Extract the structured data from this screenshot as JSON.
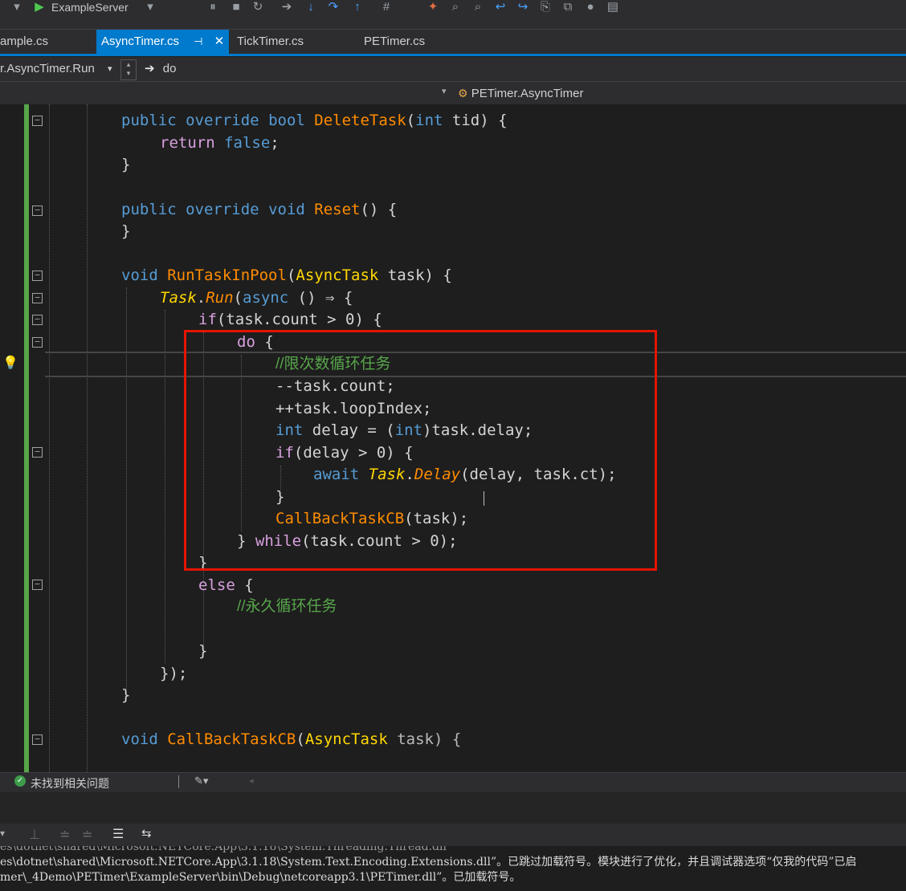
{
  "toolbar": {
    "run_target": "ExampleServer"
  },
  "tabs": [
    {
      "label": "ample.cs"
    },
    {
      "label": "AsyncTimer.cs"
    },
    {
      "label": "TickTimer.cs"
    },
    {
      "label": "PETimer.cs"
    }
  ],
  "nav": {
    "member_dropdown": "r.AsyncTimer.Run",
    "scope": "do",
    "class_dropdown": "PETimer.AsyncTimer"
  },
  "code": {
    "l1": {
      "a": "public",
      "b": "override",
      "c": "bool",
      "fn": "DeleteTask",
      "p1": "(",
      "t": "int",
      "rest": " tid) {"
    },
    "l2": {
      "kw": "return",
      "v": "false",
      "end": ";"
    },
    "l3": "}",
    "l4": {
      "a": "public",
      "b": "override",
      "c": "void",
      "fn": "Reset",
      "rest": "() {"
    },
    "l5": "}",
    "l6": {
      "a": "void",
      "fn": "RunTaskInPool",
      "p1": "(",
      "ty": "AsyncTask",
      "rest": " task) {"
    },
    "l7": {
      "ty": "Task",
      "dot": ".",
      "fn": "Run",
      "p": "(",
      "kw": "async",
      "rest": " () ⇒ {"
    },
    "l8": {
      "kw": "if",
      "rest": "(task.count > 0) {"
    },
    "l9": {
      "kw": "do",
      "rest": " {"
    },
    "l10": "//限次数循环任务",
    "l11": "--task.count;",
    "l12": "++task.loopIndex;",
    "l13": {
      "kw": "int",
      "a": " delay = (",
      "kw2": "int",
      "rest": ")task.delay;"
    },
    "l14": {
      "kw": "if",
      "rest": "(delay > 0) {"
    },
    "l15": {
      "kw": "await",
      "sp": " ",
      "ty": "Task",
      "dot": ".",
      "fn": "Delay",
      "rest": "(delay, task.ct);"
    },
    "l16": "}",
    "l17": {
      "fn": "CallBackTaskCB",
      "rest": "(task);"
    },
    "l18": {
      "a": "} ",
      "kw": "while",
      "rest": "(task.count > 0);"
    },
    "l19": "}",
    "l20": {
      "kw": "else",
      "rest": " {"
    },
    "l21": "//永久循环任务",
    "l22": "}",
    "l23": "});",
    "l24": "}",
    "l25": {
      "a": "void",
      "fn": "CallBackTaskCB",
      "p1": "(",
      "ty": "AsyncTask",
      "rest": " task) {"
    }
  },
  "status": {
    "issues": "未找到相关问题"
  },
  "output": {
    "line1": "es\\dotnet\\shared\\Microsoft.NETCore.App\\3.1.18\\System.Text.Encoding.Extensions.dll”。已跳过加载符号。模块进行了优化，并且调试器选项“仅我的代码”已启",
    "line2": "mer\\_4Demo\\PETimer\\ExampleServer\\bin\\Debug\\netcoreapp3.1\\PETimer.dll”。已加载符号。"
  },
  "colors": {
    "accent": "#007acc",
    "highlight_box": "#e51400",
    "comment": "#57a64a",
    "keyword": "#569cd6",
    "function": "#ff8c00",
    "type": "#ffd700"
  }
}
